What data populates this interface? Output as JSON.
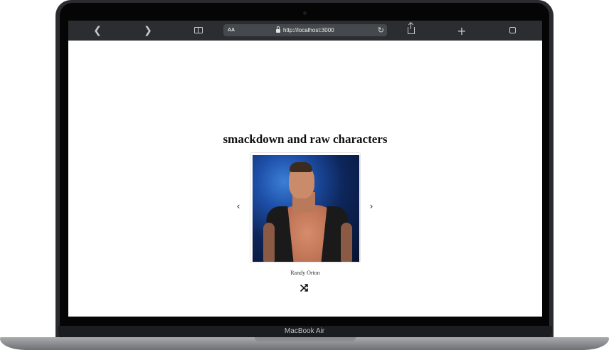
{
  "device": {
    "label": "MacBook Air"
  },
  "browser": {
    "text_size_label": "AA",
    "url": "http://localhost:3000",
    "icons": {
      "back": "chevron-left-icon",
      "forward": "chevron-right-icon",
      "reader": "book-icon",
      "reload": "reload-icon",
      "share": "share-icon",
      "new_tab": "plus-icon",
      "tabs": "tabs-icon"
    }
  },
  "page": {
    "heading": "smackdown and raw characters",
    "character": {
      "name": "Randy Orton"
    },
    "controls": {
      "prev_icon": "chevron-left-icon",
      "next_icon": "chevron-right-icon",
      "shuffle_icon": "shuffle-icon"
    }
  },
  "colors": {
    "toolbar_bg": "#2b2d30",
    "address_bg": "#45484d",
    "page_bg": "#ffffff",
    "heading_color": "#111111"
  }
}
